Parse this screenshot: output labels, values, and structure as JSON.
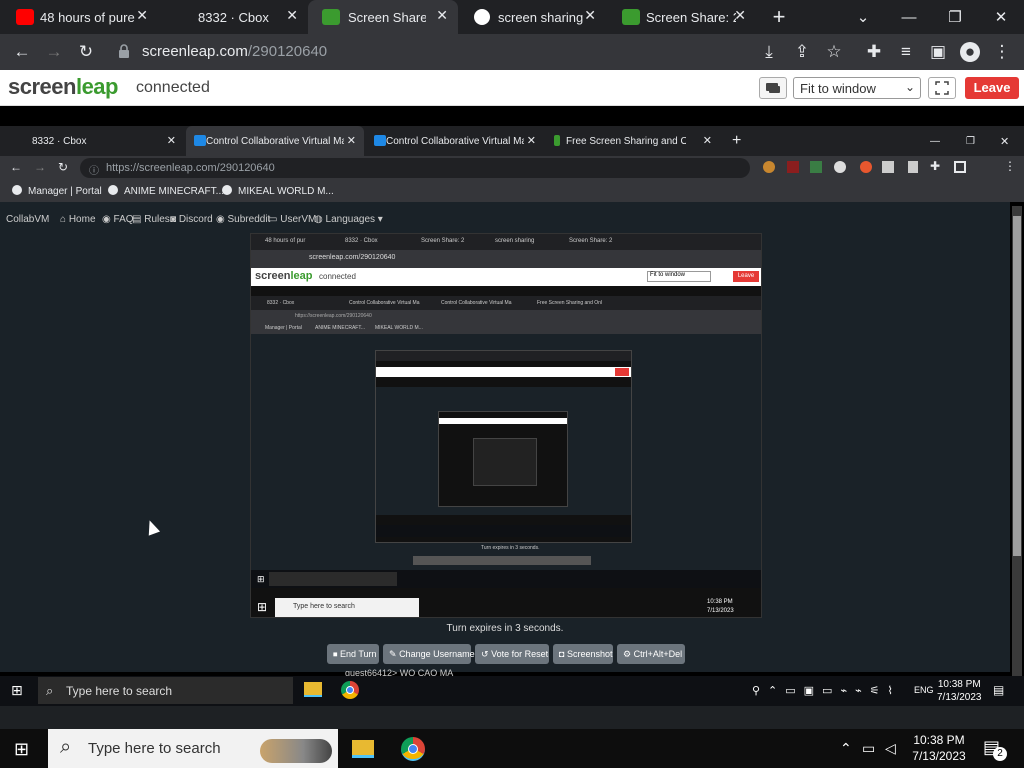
{
  "outer_browser": {
    "tabs": [
      {
        "title": "48 hours of pure",
        "favicon_color": "#ff0000"
      },
      {
        "title": "8332 · Cbox",
        "favicon_color": "#444444"
      },
      {
        "title": "Screen Share: 2",
        "favicon_color": "#3b9b2f"
      },
      {
        "title": "screen sharing",
        "favicon_color": "#4285f4"
      },
      {
        "title": "Screen Share: 2",
        "favicon_color": "#3b9b2f"
      }
    ],
    "active_tab_index": 2,
    "new_tab": "+",
    "url": {
      "domain": "screenleap.com",
      "path": "/290120640"
    }
  },
  "screenleap": {
    "logo_screen": "screen",
    "logo_leap": "leap",
    "status": "connected",
    "fit_label": "Fit to window",
    "leave_label": "Leave",
    "accent": "#e53935"
  },
  "remote": {
    "tabs": [
      {
        "title": "8332 · Cbox"
      },
      {
        "title": "Control Collaborative Virtual Ma"
      },
      {
        "title": "Control Collaborative Virtual Ma"
      },
      {
        "title": "Free Screen Sharing and Onl"
      }
    ],
    "new_tab": "+",
    "url": "https://screenleap.com/290120640",
    "bookmarks": [
      "Manager | Portal",
      "ANIME MINECRAFT...",
      "MIKEAL WORLD M..."
    ],
    "nav": {
      "brand": "CollabVM",
      "links": [
        "Home",
        "FAQ",
        "Rules",
        "Discord",
        "Subreddit",
        "UserVM",
        "Languages ▾"
      ]
    },
    "turn_text": "Turn expires in 3 seconds.",
    "buttons": [
      "End Turn",
      "Change Username",
      "Vote for Reset",
      "Screenshot",
      "Ctrl+Alt+Del"
    ],
    "chat_line": "guest66412> WO CAO MA",
    "taskbar": {
      "search_placeholder": "Type here to search",
      "language": "ENG",
      "time": "10:38 PM",
      "date": "7/13/2023"
    },
    "vm_screen": {
      "tabs": [
        "48 hours of pur",
        "8332 · Cbox",
        "Screen Share: 2",
        "screen sharing",
        "Screen Share: 2"
      ],
      "url": "screenleap.com/290120640",
      "status": "connected",
      "fit_label": "Fit to window",
      "leave_label": "Leave",
      "inner_tabs": [
        "8332 · Cbox",
        "Control Collaborative Virtual Ma",
        "Control Collaborative Virtual Ma",
        "Free Screen Sharing and Onl"
      ],
      "inner_url": "https://screenleap.com/290120640",
      "inner_bookmarks": [
        "Manager | Portal",
        "ANIME MINECRAFT...",
        "MIKEAL WORLD M..."
      ],
      "turn_text": "Turn expires in 3 seconds.",
      "search_placeholder": "Type here to search",
      "time": "10:38 PM",
      "date": "7/13/2023"
    }
  },
  "taskbar": {
    "search_placeholder": "Type here to search",
    "time": "10:38 PM",
    "date": "7/13/2023",
    "notification_count": "2"
  }
}
